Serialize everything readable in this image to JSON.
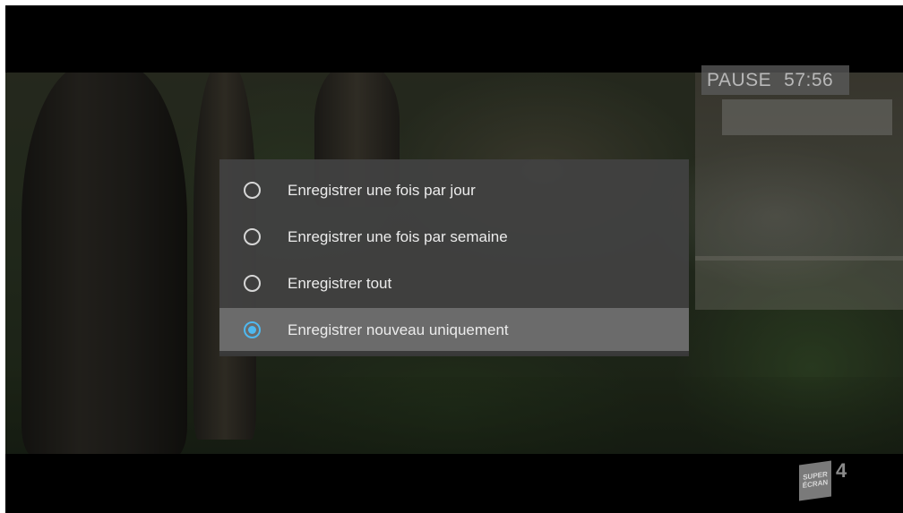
{
  "overlay": {
    "status": "PAUSE",
    "time": "57:56"
  },
  "dialog": {
    "options": [
      {
        "label": "Enregistrer une fois par jour",
        "selected": false
      },
      {
        "label": "Enregistrer une fois par semaine",
        "selected": false
      },
      {
        "label": "Enregistrer tout",
        "selected": false
      },
      {
        "label": "Enregistrer nouveau uniquement",
        "selected": true
      }
    ]
  },
  "channel": {
    "logo_line1": "SUPER",
    "logo_line2": "ÉCRAN",
    "number": "4"
  },
  "colors": {
    "radio_accent": "#4fb9f0",
    "dialog_bg": "#424242",
    "selected_row_bg": "#707070"
  }
}
